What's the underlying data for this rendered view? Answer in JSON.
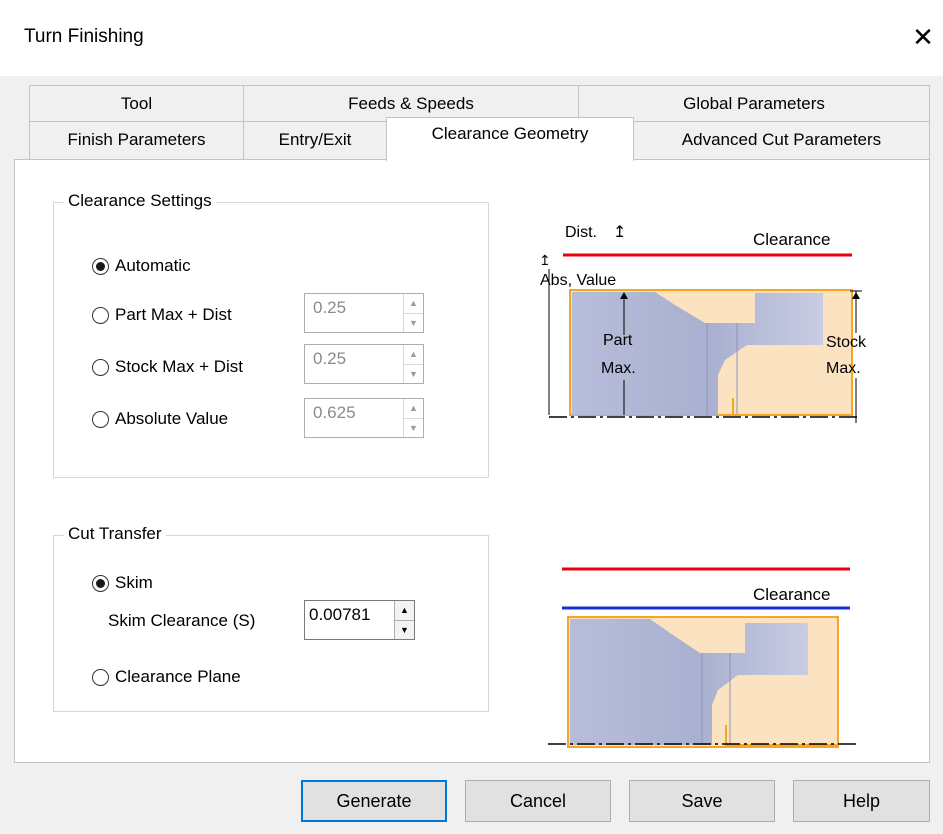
{
  "window": {
    "title": "Turn Finishing",
    "close_glyph": "✕"
  },
  "tabs_row1": [
    {
      "label": "Tool"
    },
    {
      "label": "Feeds & Speeds"
    },
    {
      "label": "Global Parameters"
    }
  ],
  "tabs_row2": [
    {
      "label": "Finish Parameters"
    },
    {
      "label": "Entry/Exit"
    },
    {
      "label": "Clearance Geometry",
      "active": true
    },
    {
      "label": "Advanced Cut Parameters"
    }
  ],
  "clearance_settings": {
    "legend": "Clearance Settings",
    "options": [
      {
        "label": "Automatic",
        "checked": true
      },
      {
        "label": "Part Max + Dist",
        "value": "0.25",
        "enabled": false
      },
      {
        "label": "Stock Max + Dist",
        "value": "0.25",
        "enabled": false
      },
      {
        "label": "Absolute Value",
        "value": "0.625",
        "enabled": false
      }
    ]
  },
  "cut_transfer": {
    "legend": "Cut Transfer",
    "skim": {
      "label": "Skim",
      "checked": true
    },
    "skim_clearance": {
      "label": "Skim Clearance (S)",
      "value": "0.00781",
      "enabled": true
    },
    "clearance_plane": {
      "label": "Clearance Plane",
      "checked": false
    }
  },
  "diagram_top": {
    "dist_label": "Dist.",
    "clearance_label": "Clearance",
    "abs_value_label": "Abs, Value",
    "part_max_label_1": "Part",
    "part_max_label_2": "Max.",
    "stock_max_label_1": "Stock",
    "stock_max_label_2": "Max."
  },
  "diagram_bottom": {
    "clearance_label": "Clearance"
  },
  "buttons": {
    "generate": "Generate",
    "cancel": "Cancel",
    "save": "Save",
    "help": "Help"
  },
  "colors": {
    "clearance_line": "#e8000d",
    "skim_line": "#1c2fd6",
    "stock_fill": "#fbe3c1",
    "stock_outline": "#f5a623",
    "part_fill": "#b9bfd8",
    "focus_border": "#0078d7"
  }
}
